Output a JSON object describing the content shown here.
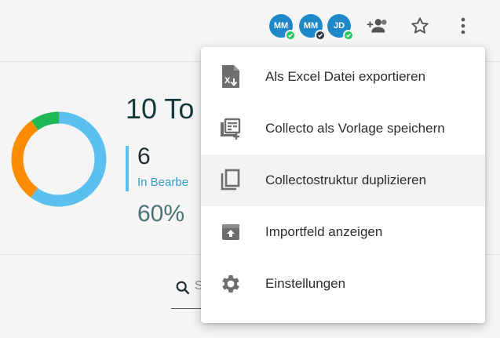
{
  "header": {
    "avatars": [
      {
        "initials": "MM",
        "color": "#1e88c9",
        "status": "ok"
      },
      {
        "initials": "MM",
        "color": "#1e88c9",
        "status": "dark"
      },
      {
        "initials": "JD",
        "color": "#1e88c9",
        "status": "ok"
      }
    ],
    "icons": [
      "add-people-icon",
      "star-icon",
      "more-vert-icon"
    ]
  },
  "stats": {
    "total_label": "10 To",
    "in_progress_count": "6",
    "in_progress_label": "In Bearbe",
    "percent": "60%",
    "donut": {
      "segments": [
        {
          "name": "blue",
          "fraction": 0.6,
          "color": "#5bc0f0"
        },
        {
          "name": "orange",
          "fraction": 0.3,
          "color": "#fb8c00"
        },
        {
          "name": "green",
          "fraction": 0.1,
          "color": "#1db954"
        }
      ]
    }
  },
  "search": {
    "partial_text": "S"
  },
  "menu": {
    "items": [
      {
        "label": "Als Excel Datei exportieren",
        "icon": "excel-export-icon"
      },
      {
        "label": "Collecto als Vorlage speichern",
        "icon": "save-template-icon"
      },
      {
        "label": "Collectostruktur duplizieren",
        "icon": "duplicate-icon",
        "active": true
      },
      {
        "label": "Importfeld anzeigen",
        "icon": "import-icon"
      },
      {
        "label": "Einstellungen",
        "icon": "settings-icon"
      }
    ]
  }
}
